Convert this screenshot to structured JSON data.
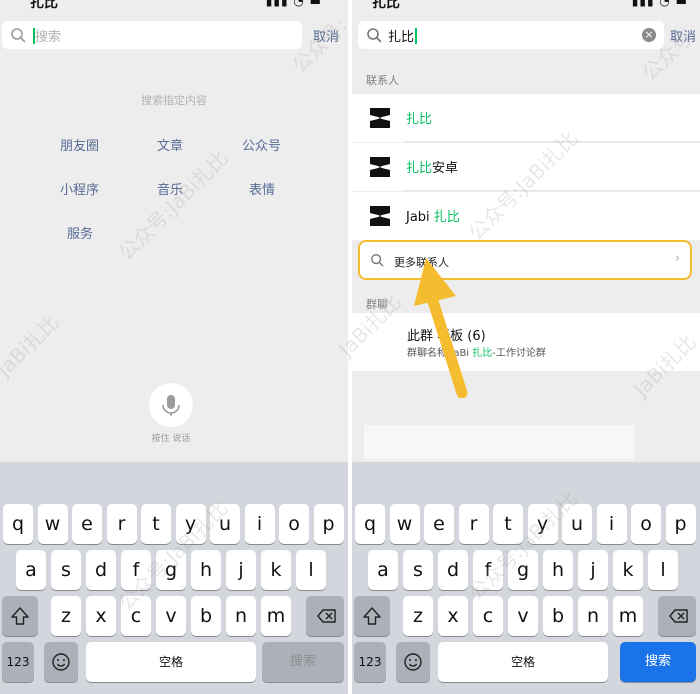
{
  "left": {
    "status_title": "扎比",
    "search_placeholder": "搜索",
    "cancel": "取消",
    "hint": "搜索指定内容",
    "categories": [
      "朋友圈",
      "文章",
      "公众号",
      "小程序",
      "音乐",
      "表情",
      "服务"
    ],
    "voice_label": "按住 说话",
    "keyboard": {
      "row1": [
        "q",
        "w",
        "e",
        "r",
        "t",
        "y",
        "u",
        "i",
        "o",
        "p"
      ],
      "row2": [
        "a",
        "s",
        "d",
        "f",
        "g",
        "h",
        "j",
        "k",
        "l"
      ],
      "row3": [
        "z",
        "x",
        "c",
        "v",
        "b",
        "n",
        "m"
      ],
      "num_key": "123",
      "space": "空格",
      "search_key": "搜索"
    }
  },
  "right": {
    "status_title": "扎比",
    "search_query": "扎比",
    "cancel": "取消",
    "contacts_label": "联系人",
    "contacts": [
      {
        "name_green": "扎比",
        "name_rest": ""
      },
      {
        "name_green": "扎比",
        "name_rest": "安卓"
      },
      {
        "name_pre": "Jabi ",
        "name_green": "扎比"
      }
    ],
    "more_contacts": "更多联系人",
    "groups_label": "群聊",
    "group": {
      "name": "此群    老板 (6)",
      "sub_pre": "群聊名称:JaBi ",
      "sub_green": "扎比",
      "sub_post": "-工作讨论群"
    },
    "punctuation": [
      ",",
      "。",
      "?",
      "!",
      "、",
      "……"
    ],
    "keyboard": {
      "row1": [
        "q",
        "w",
        "e",
        "r",
        "t",
        "y",
        "u",
        "i",
        "o",
        "p"
      ],
      "row2": [
        "a",
        "s",
        "d",
        "f",
        "g",
        "h",
        "j",
        "k",
        "l"
      ],
      "row3": [
        "z",
        "x",
        "c",
        "v",
        "b",
        "n",
        "m"
      ],
      "num_key": "123",
      "space": "空格",
      "search_key": "搜索"
    }
  },
  "watermarks": [
    "JaBi扎比",
    "公众号:JaBi扎比",
    "公众号:JaBi扎比",
    "JaBi扎比",
    "公众号:",
    "公众号:JaBi扎比",
    "公众号:JaBi扎比",
    "JaBi扎比",
    "公众号"
  ],
  "colors": {
    "accent_green": "#07c160",
    "link_blue": "#576b95",
    "highlight_yellow": "#f6bc2f",
    "search_key_blue": "#1a73e8"
  }
}
